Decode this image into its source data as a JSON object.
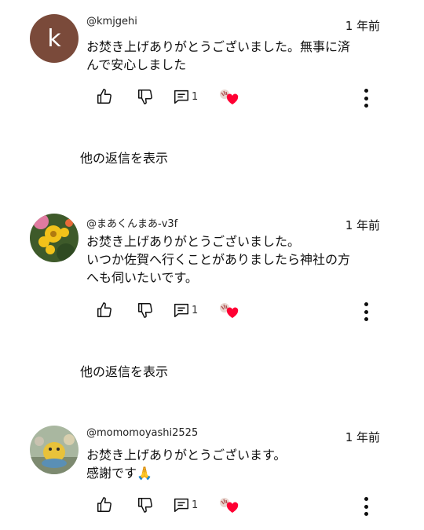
{
  "comments": [
    {
      "avatar_letter": "k",
      "author": "@kmjgehi",
      "time": "1 年前",
      "lines": [
        "お焚き上げありがとうございました。無事に済",
        "んで安心しました"
      ],
      "reply_count": "1"
    },
    {
      "author": "@まあくんまあ-v3f",
      "time": "1 年前",
      "lines": [
        "お焚き上げありがとうございました。",
        "いつか佐賀へ行くことがありましたら神社の方",
        "へも伺いたいです。"
      ],
      "reply_count": "1"
    },
    {
      "author": "@momomoyashi2525",
      "time": "1 年前",
      "lines": [
        "お焚き上げありがとうございます。",
        "感謝です🙏"
      ],
      "reply_count": "1"
    }
  ],
  "show_replies_label": "他の返信を表示",
  "icons": {
    "like": "thumb-up-icon",
    "dislike": "thumb-down-icon",
    "reply": "comment-icon",
    "creator_heart": "creator-heart-icon",
    "more": "more-vertical-icon"
  },
  "colors": {
    "heart": "#ff0033",
    "avatar_k": "#7a4a3a"
  }
}
